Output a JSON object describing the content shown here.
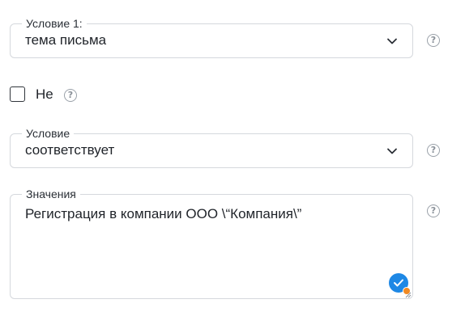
{
  "condition1": {
    "label": "Условие 1:",
    "value": "тема письма"
  },
  "negation": {
    "label": "Не",
    "checked": false
  },
  "condition": {
    "label": "Условие",
    "value": "соответствует"
  },
  "values": {
    "label": "Значения",
    "value": "Регистрация в компании ООО \\“Компания\\”"
  },
  "icons": {
    "dropdown": "chevron-down-icon",
    "help": "question-circle-icon",
    "status": "check-circle-icon",
    "resize": "resize-handle-icon"
  },
  "colors": {
    "border": "#d5d8dd",
    "accent": "#1e88e5",
    "status_dot": "#f08a24",
    "help": "#9aa1a9"
  }
}
